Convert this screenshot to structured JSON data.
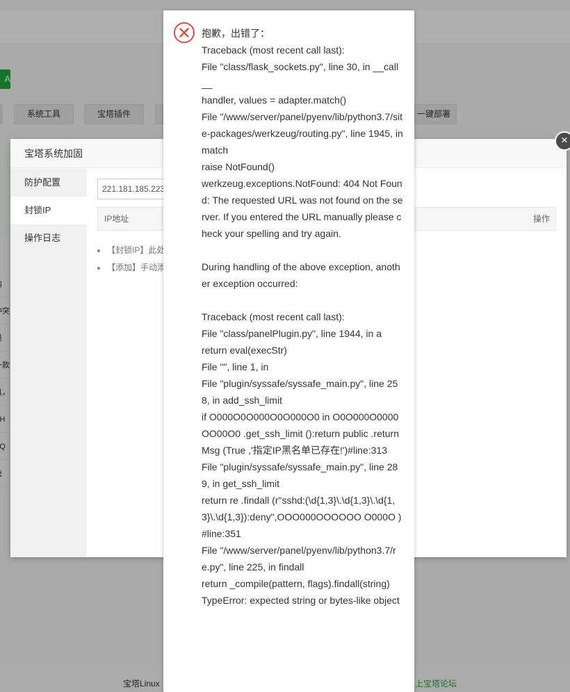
{
  "background": {
    "green_button_label": "A",
    "tabs": [
      {
        "label": ""
      },
      {
        "label": "系统工具"
      },
      {
        "label": "宝塔插件"
      },
      {
        "label": ""
      },
      {
        "label": "一键部署"
      }
    ],
    "left_fragments": [
      "内",
      "冲突",
      "最",
      "一款",
      "具，",
      "SH",
      "SQ",
      "统"
    ],
    "footer_text": "宝塔Linux",
    "footer_link": "上宝塔论坛"
  },
  "plugin_dialog": {
    "title": "宝塔系统加固",
    "sidebar": [
      {
        "label": "防护配置"
      },
      {
        "label": "封锁IP"
      },
      {
        "label": "操作日志"
      }
    ],
    "active_index": 1,
    "ip_input_value": "221.181.185.223",
    "table_headers": {
      "ip": "IP地址",
      "action": "操作"
    },
    "tips": [
      "【封锁IP】此处",
      "【添加】手动添"
    ],
    "close_glyph": "×"
  },
  "error_popup": {
    "icon": "error-circle-x-icon",
    "message": "抱歉，出错了：\nTraceback (most recent call last):\nFile \"class/flask_sockets.py\", line 30, in __call__\nhandler, values = adapter.match()\nFile \"/www/server/panel/pyenv/lib/python3.7/site-packages/werkzeug/routing.py\", line 1945, in match\nraise NotFound()\nwerkzeug.exceptions.NotFound: 404 Not Found: The requested URL was not found on the server. If you entered the URL manually please check your spelling and try again.\n\nDuring handling of the above exception, another exception occurred:\n\nTraceback (most recent call last):\nFile \"class/panelPlugin.py\", line 1944, in a\nreturn eval(execStr)\nFile \"\", line 1, in\nFile \"plugin/syssafe/syssafe_main.py\", line 258, in add_ssh_limit\nif O000O0O000O0O000O0 in O0O000O0000OO00O0 .get_ssh_limit ():return public .returnMsg (True ,'指定IP黑名单已存在!')#line:313\nFile \"plugin/syssafe/syssafe_main.py\", line 289, in get_ssh_limit\nreturn re .findall (r\"sshd:(\\d{1,3}\\.\\d{1,3}\\.\\d{1,3}\\.\\d{1,3}):deny\",OOO000OOOOOO O000O )#line:351\nFile \"/www/server/panel/pyenv/lib/python3.7/re.py\", line 225, in findall\nreturn _compile(pattern, flags).findall(string)\nTypeError: expected string or bytes-like object"
  },
  "colors": {
    "accent_green": "#20a53a",
    "error_red": "#e84c3d"
  }
}
